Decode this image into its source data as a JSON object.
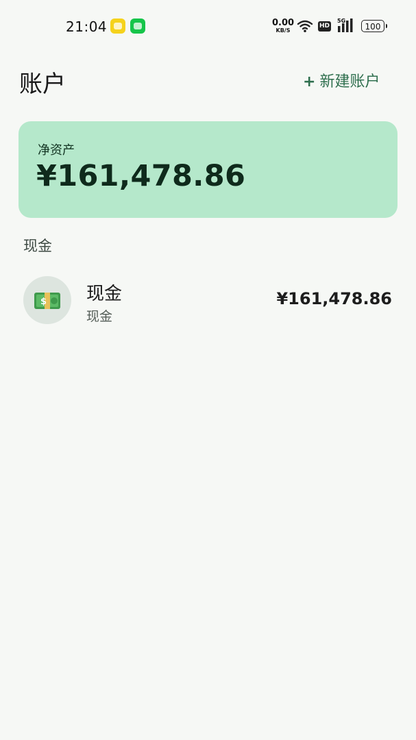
{
  "status_bar": {
    "time": "21:04",
    "net_speed_value": "0.00",
    "net_speed_unit": "KB/S",
    "hd_label": "HD",
    "network_label": "5G",
    "battery": "100",
    "icons": [
      "app-icon-yellow",
      "app-icon-green",
      "wifi-icon",
      "signal-icon",
      "battery-icon"
    ]
  },
  "header": {
    "title": "账户",
    "new_account_plus": "+",
    "new_account_label": "新建账户"
  },
  "net_worth": {
    "label": "净资产",
    "value": "¥161,478.86"
  },
  "sections": [
    {
      "title": "现金",
      "accounts": [
        {
          "name": "现金",
          "type": "现金",
          "balance": "¥161,478.86",
          "icon": "money-icon"
        }
      ]
    }
  ],
  "colors": {
    "background": "#f6f8f5",
    "accent": "#2f6f4e",
    "card": "#b5e8cb",
    "avatar_bg": "#dde5df"
  }
}
